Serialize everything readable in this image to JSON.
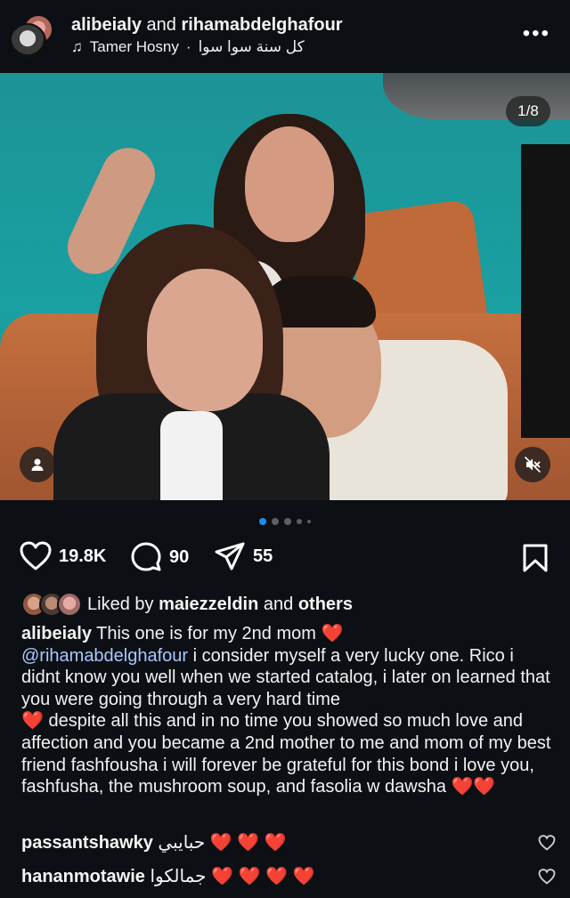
{
  "header": {
    "author_primary": "alibeialy",
    "conjunction": "and",
    "author_secondary": "rihamabdelghafour",
    "music_artist": "Tamer Hosny",
    "music_separator": "·",
    "music_title": "كل سنة سوا سوا",
    "more_label": "•••"
  },
  "media": {
    "page_counter": "1/8",
    "current_index": 1,
    "total_slides": 8
  },
  "actions": {
    "likes_count": "19.8K",
    "comments_count": "90",
    "shares_count": "55"
  },
  "likes": {
    "prefix": "Liked by",
    "user": "maiezzeldin",
    "and": "and",
    "others": "others"
  },
  "caption": {
    "user": "alibeialy",
    "text_1": "This one is for my 2nd mom",
    "mention": "@rihamabdelghafour",
    "text_2": "i consider myself a very lucky one. Rico i didnt know you well when we started catalog, i later on learned that you were going through a very hard time",
    "text_3": "despite all this and in no time you showed so much love and affection and you became a 2nd mother to me and mom of my best friend fashfousha i will forever be grateful for this bond i love you, fashfusha, the mushroom soup, and fasolia w dawsha",
    "heart": "❤️"
  },
  "comments": [
    {
      "user": "passantshawky",
      "text": "حبايبي",
      "hearts": "❤️ ❤️ ❤️"
    },
    {
      "user": "hananmotawie",
      "text": "جمالكوا",
      "hearts": "❤️ ❤️ ❤️ ❤️"
    }
  ],
  "colors": {
    "background": "#0c1014",
    "text": "#f5f5f5",
    "mention": "#a9c7ff",
    "active_dot": "#1d8cf0",
    "heart": "#e0232e"
  }
}
